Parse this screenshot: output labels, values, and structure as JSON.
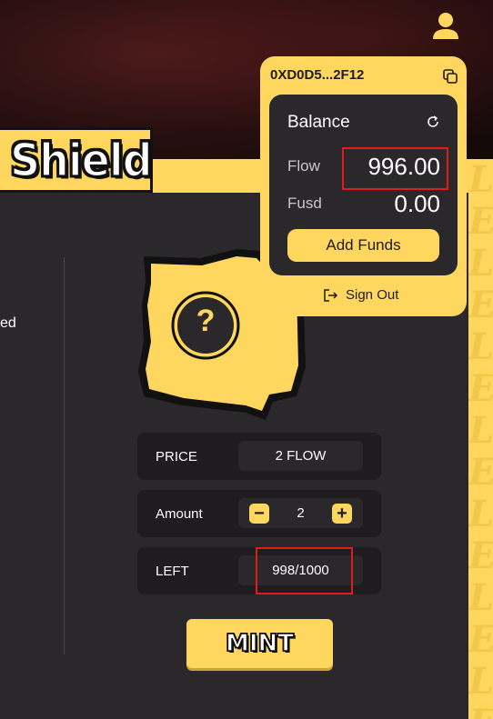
{
  "hero": {
    "title": "Shield"
  },
  "side": {
    "text": "ed"
  },
  "mystery": {
    "glyph": "?"
  },
  "info": {
    "price_label": "PRICE",
    "price_value": "2 FLOW",
    "amount_label": "Amount",
    "amount_value": "2",
    "minus": "−",
    "plus": "+",
    "left_label": "LEFT",
    "left_value": "998/1000"
  },
  "mint": {
    "label": "MINT"
  },
  "wallet": {
    "address": "0XD0D5...2F12",
    "balance_title": "Balance",
    "tokens": [
      {
        "label": "Flow",
        "value": "996.00"
      },
      {
        "label": "Fusd",
        "value": "0.00"
      }
    ],
    "add_funds": "Add Funds",
    "sign_out": "Sign Out"
  },
  "decor": {
    "band_letters": "LELELELELELELELELELELELELELE"
  },
  "colors": {
    "accent": "#ffd75e",
    "panel": "#2a282b",
    "card": "#1e1c1f",
    "highlight": "#e01b1b"
  }
}
